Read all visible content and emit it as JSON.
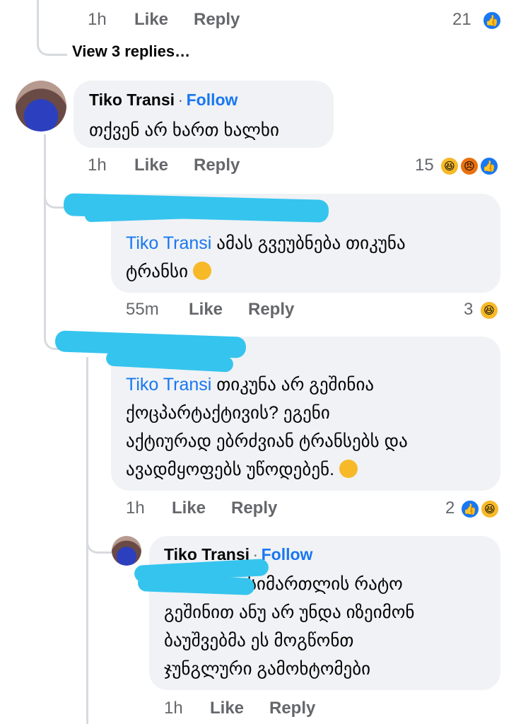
{
  "top_meta": {
    "time": "1h",
    "like": "Like",
    "reply": "Reply",
    "count": "21"
  },
  "view_replies": "View 3 replies…",
  "comments": [
    {
      "author": "Tiko Transi",
      "separator": "·",
      "follow": "Follow",
      "text": "თქვენ არ ხართ ხალხი",
      "time": "1h",
      "like": "Like",
      "reply": "Reply",
      "reaction_count": "15",
      "reactions": [
        "haha",
        "angry",
        "like"
      ]
    },
    {
      "author": "",
      "mention": "Tiko Transi",
      "text_line1": " ამას გვეუბნება თიკუნა",
      "text_line2": "ტრანსი",
      "emoji": "grinning-squinting-face",
      "time": "55m",
      "like": "Like",
      "reply": "Reply",
      "reaction_count": "3",
      "reactions": [
        "haha"
      ]
    },
    {
      "author": "",
      "mention": "Tiko Transi",
      "text_line1": " თიკუნა არ გეშინია",
      "text_line2": "ქოცპარტაქტივის? ეგენი",
      "text_line3": "აქტიურად ებრძვიან ტრანსებს და",
      "text_line4": "ავადმყოფებს უწოდებენ.",
      "emoji": "thinking-face",
      "time": "1h",
      "like": "Like",
      "reply": "Reply",
      "reaction_count": "2",
      "reactions": [
        "like",
        "haha"
      ]
    },
    {
      "author": "Tiko Transi",
      "separator": "·",
      "follow": "Follow",
      "text_line1": "სიმართლის რატო",
      "text_line2": "გეშინით ანუ არ უნდა იზეიმონ",
      "text_line3": "ბაუშვებმა ეს მოგწონთ",
      "text_line4": "ჯუნგლური გამოხტომები",
      "time": "1h",
      "like": "Like",
      "reply": "Reply"
    }
  ],
  "colors": {
    "accent": "#1877f2",
    "bubble": "#f0f2f5",
    "meta": "#65676b",
    "redaction": "#35c4ee"
  }
}
